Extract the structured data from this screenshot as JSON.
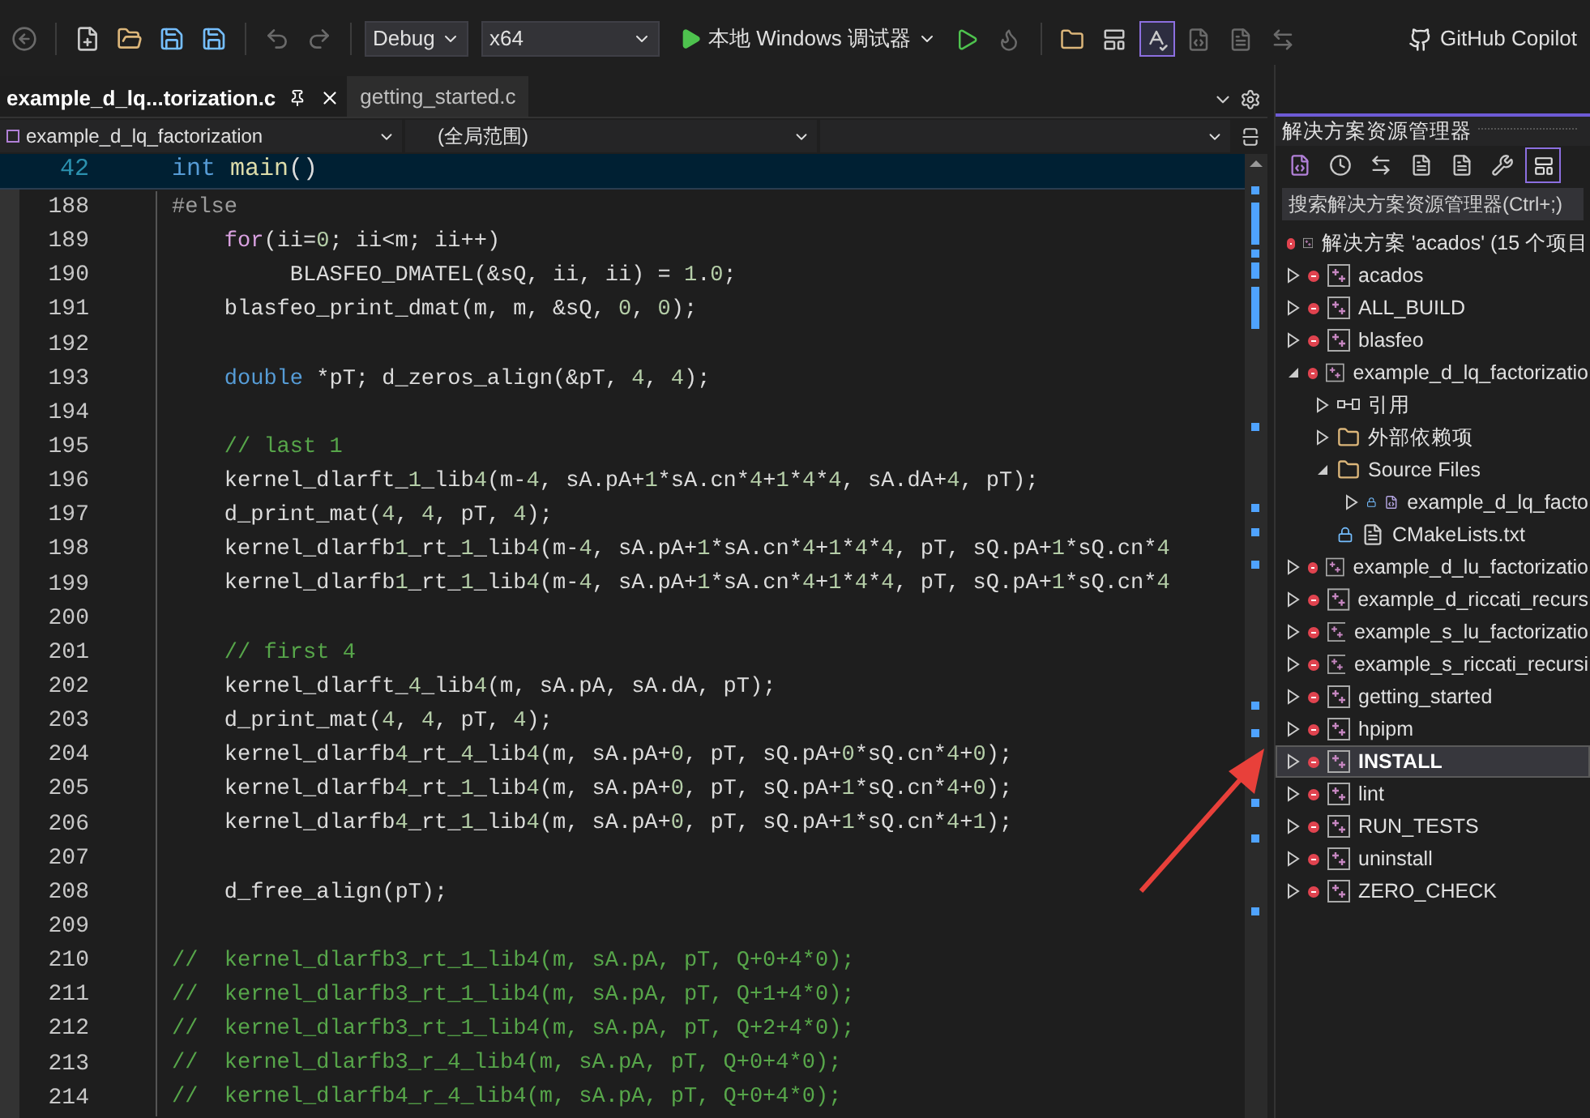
{
  "toolbar": {
    "configuration": "Debug",
    "platform": "x64",
    "run_label": "本地 Windows 调试器",
    "copilot": "GitHub Copilot",
    "spell_check_active": true
  },
  "editor": {
    "tabs": [
      {
        "label": "example_d_lq...torization.c",
        "selected": true
      },
      {
        "label": "getting_started.c",
        "selected": false
      }
    ],
    "nav": {
      "project": "example_d_lq_factorization",
      "scope": "(全局范围)"
    },
    "sticky": {
      "number": "42",
      "tokens": [
        {
          "kind": "kw",
          "text": "int"
        },
        {
          "kind": "fn",
          "text": " main"
        },
        {
          "kind": "plain",
          "text": "()"
        }
      ]
    },
    "lines": [
      {
        "number": "188",
        "tokens": [
          {
            "kind": "pp",
            "text": "#else"
          }
        ]
      },
      {
        "number": "189",
        "tokens": [
          {
            "kind": "ctl",
            "text": "    for"
          },
          {
            "kind": "plain",
            "text": "(ii=0; ii<m; ii++)"
          }
        ]
      },
      {
        "number": "190",
        "tokens": [
          {
            "kind": "plain",
            "text": "         BLASFEO_DMATEL(&sQ, ii, ii) = 1.0;"
          }
        ]
      },
      {
        "number": "191",
        "tokens": [
          {
            "kind": "plain",
            "text": "    blasfeo_print_dmat(m, m, &sQ, 0, 0);"
          }
        ]
      },
      {
        "number": "192"
      },
      {
        "number": "193",
        "tokens": [
          {
            "kind": "kw",
            "text": "    double"
          },
          {
            "kind": "plain",
            "text": " *pT; d_zeros_align(&pT, 4, 4);"
          }
        ]
      },
      {
        "number": "194"
      },
      {
        "number": "195",
        "tokens": [
          {
            "kind": "cm",
            "text": "    // last 1"
          }
        ]
      },
      {
        "number": "196",
        "tokens": [
          {
            "kind": "plain",
            "text": "    kernel_dlarft_1_lib4(m-4, sA.pA+1*sA.cn*4+1*4*4, sA.dA+4, pT);"
          }
        ]
      },
      {
        "number": "197",
        "tokens": [
          {
            "kind": "plain",
            "text": "    d_print_mat(4, 4, pT, 4);"
          }
        ]
      },
      {
        "number": "198",
        "tokens": [
          {
            "kind": "plain",
            "text": "    kernel_dlarfb1_rt_1_lib4(m-4, sA.pA+1*sA.cn*4+1*4*4, pT, sQ.pA+1*sQ.cn*4"
          }
        ]
      },
      {
        "number": "199",
        "tokens": [
          {
            "kind": "plain",
            "text": "    kernel_dlarfb1_rt_1_lib4(m-4, sA.pA+1*sA.cn*4+1*4*4, pT, sQ.pA+1*sQ.cn*4"
          }
        ]
      },
      {
        "number": "200"
      },
      {
        "number": "201",
        "tokens": [
          {
            "kind": "cm",
            "text": "    // first 4"
          }
        ]
      },
      {
        "number": "202",
        "tokens": [
          {
            "kind": "plain",
            "text": "    kernel_dlarft_4_lib4(m, sA.pA, sA.dA, pT);"
          }
        ]
      },
      {
        "number": "203",
        "tokens": [
          {
            "kind": "plain",
            "text": "    d_print_mat(4, 4, pT, 4);"
          }
        ]
      },
      {
        "number": "204",
        "tokens": [
          {
            "kind": "plain",
            "text": "    kernel_dlarfb4_rt_4_lib4(m, sA.pA+0, pT, sQ.pA+0*sQ.cn*4+0);"
          }
        ]
      },
      {
        "number": "205",
        "tokens": [
          {
            "kind": "plain",
            "text": "    kernel_dlarfb4_rt_1_lib4(m, sA.pA+0, pT, sQ.pA+1*sQ.cn*4+0);"
          }
        ]
      },
      {
        "number": "206",
        "tokens": [
          {
            "kind": "plain",
            "text": "    kernel_dlarfb4_rt_1_lib4(m, sA.pA+0, pT, sQ.pA+1*sQ.cn*4+1);"
          }
        ]
      },
      {
        "number": "207"
      },
      {
        "number": "208",
        "tokens": [
          {
            "kind": "plain",
            "text": "    d_free_align(pT);"
          }
        ]
      },
      {
        "number": "209"
      },
      {
        "number": "210",
        "tokens": [
          {
            "kind": "cm",
            "text": "//  kernel_dlarfb3_rt_1_lib4(m, sA.pA, pT, Q+0+4*0);"
          }
        ]
      },
      {
        "number": "211",
        "tokens": [
          {
            "kind": "cm",
            "text": "//  kernel_dlarfb3_rt_1_lib4(m, sA.pA, pT, Q+1+4*0);"
          }
        ]
      },
      {
        "number": "212",
        "tokens": [
          {
            "kind": "cm",
            "text": "//  kernel_dlarfb3_rt_1_lib4(m, sA.pA, pT, Q+2+4*0);"
          }
        ]
      },
      {
        "number": "213",
        "tokens": [
          {
            "kind": "cm",
            "text": "//  kernel_dlarfb3_r_4_lib4(m, sA.pA, pT, Q+0+4*0);"
          }
        ]
      },
      {
        "number": "214",
        "tokens": [
          {
            "kind": "cm",
            "text": "//  kernel_dlarfb4_r_4_lib4(m, sA.pA, pT, Q+0+4*0);"
          }
        ]
      }
    ]
  },
  "explorer": {
    "title": "解决方案资源管理器",
    "preview_active": true,
    "search_placeholder": "搜索解决方案资源管理器(Ctrl+;)",
    "tree": [
      {
        "kind": "solution",
        "label": "解决方案 'acados' (15 个项目",
        "selected": false,
        "children": [
          {
            "kind": "project",
            "label": "acados",
            "expanded": false,
            "selected": false
          },
          {
            "kind": "project",
            "label": "ALL_BUILD",
            "expanded": false,
            "selected": false
          },
          {
            "kind": "project",
            "label": "blasfeo",
            "expanded": false,
            "selected": false
          },
          {
            "kind": "project",
            "label": "example_d_lq_factorizatio",
            "expanded": true,
            "selected": false,
            "children": [
              {
                "kind": "reference",
                "label": "引用",
                "expanded": false,
                "selected": false
              },
              {
                "kind": "external",
                "label": "外部依赖项",
                "expanded": false,
                "selected": false
              },
              {
                "kind": "folder",
                "label": "Source Files",
                "expanded": true,
                "selected": false,
                "children": [
                  {
                    "kind": "cfile",
                    "label": "example_d_lq_facto",
                    "expanded": false,
                    "selected": false
                  }
                ]
              },
              {
                "kind": "textfile",
                "label": "CMakeLists.txt",
                "selected": false
              }
            ]
          },
          {
            "kind": "project",
            "label": "example_d_lu_factorizatio",
            "expanded": false,
            "selected": false
          },
          {
            "kind": "project",
            "label": "example_d_riccati_recurs",
            "expanded": false,
            "selected": false
          },
          {
            "kind": "project",
            "label": "example_s_lu_factorizatio",
            "expanded": false,
            "selected": false
          },
          {
            "kind": "project",
            "label": "example_s_riccati_recursi",
            "expanded": false,
            "selected": false
          },
          {
            "kind": "project",
            "label": "getting_started",
            "expanded": false,
            "selected": false
          },
          {
            "kind": "project",
            "label": "hpipm",
            "expanded": false,
            "selected": false
          },
          {
            "kind": "project",
            "label": "INSTALL",
            "expanded": false,
            "selected": true
          },
          {
            "kind": "project",
            "label": "lint",
            "expanded": false,
            "selected": false
          },
          {
            "kind": "project",
            "label": "RUN_TESTS",
            "expanded": false,
            "selected": false
          },
          {
            "kind": "project",
            "label": "uninstall",
            "expanded": false,
            "selected": false
          },
          {
            "kind": "project",
            "label": "ZERO_CHECK",
            "expanded": false,
            "selected": false
          }
        ]
      }
    ]
  }
}
